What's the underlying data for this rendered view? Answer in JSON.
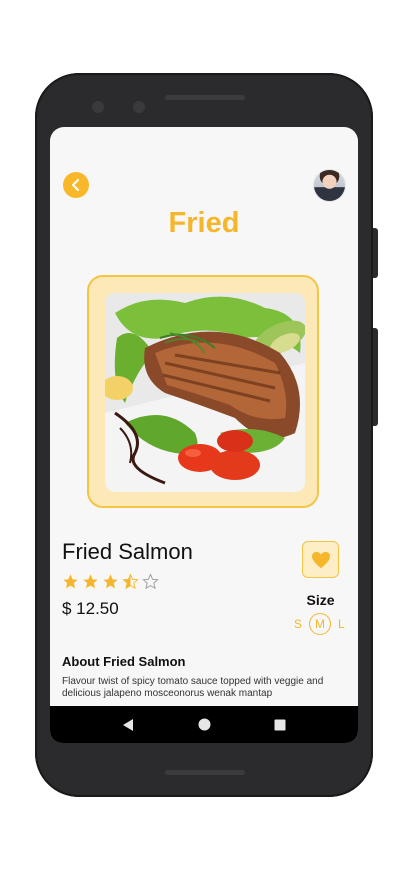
{
  "header": {
    "title": "Fried"
  },
  "product": {
    "name": "Fried Salmon",
    "rating": 3.5,
    "rating_max": 5,
    "price": "$ 12.50"
  },
  "size": {
    "label": "Size",
    "options": [
      "S",
      "M",
      "L"
    ],
    "selected": "M"
  },
  "about": {
    "title": "About Fried Salmon",
    "text": "Flavour twist of spicy tomato sauce topped with veggie and delicious jalapeno mosceonorus wenak mantap"
  },
  "icons": {
    "back": "chevron-left-icon",
    "favorite": "heart-icon",
    "nav_back": "triangle-back-icon",
    "nav_home": "circle-home-icon",
    "nav_recents": "square-recents-icon"
  },
  "colors": {
    "accent": "#f5b62c",
    "accent_light": "#fce9b7"
  }
}
